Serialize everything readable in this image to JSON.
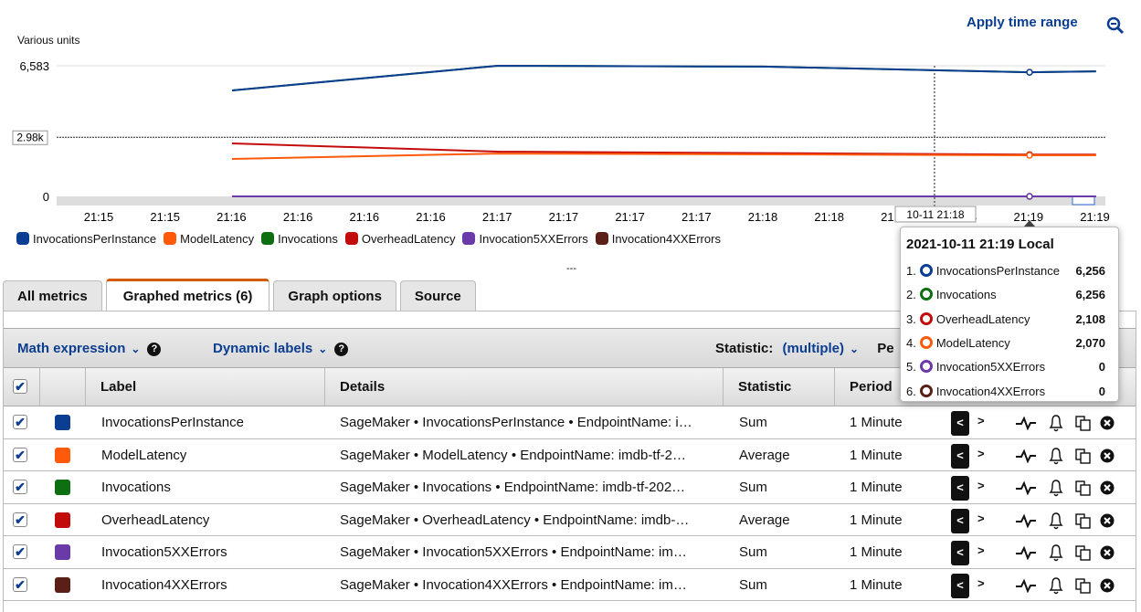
{
  "header": {
    "apply_time_range": "Apply time range",
    "zoom_icon": "zoom-out-icon"
  },
  "chart_data": {
    "type": "line",
    "ylabel": "Various units",
    "yticks": [
      "6,583",
      "0"
    ],
    "ylim": [
      0,
      6583
    ],
    "threshold_label": "2.98k",
    "threshold": 2980,
    "xtick_labels": [
      "21:15",
      "21:15",
      "21:16",
      "21:16",
      "21:16",
      "21:16",
      "21:17",
      "21:17",
      "21:17",
      "21:17",
      "21:18",
      "21:18",
      "21:18",
      "21:18",
      "21:19",
      "21:19"
    ],
    "x": [
      "21:16:00",
      "21:17:00",
      "21:18:00",
      "21:19:00",
      "21:19:15"
    ],
    "hover_x_label": "10-11 21:18",
    "series": [
      {
        "name": "InvocationsPerInstance",
        "color": "#0b3d91",
        "values": [
          5340,
          6583,
          6540,
          6256,
          6300
        ]
      },
      {
        "name": "ModelLatency",
        "color": "#ff5a0a",
        "values": [
          1890,
          2160,
          2120,
          2070,
          2070
        ]
      },
      {
        "name": "Invocations",
        "color": "#0e6e12",
        "values": [
          5340,
          6583,
          6540,
          6256,
          6300
        ]
      },
      {
        "name": "OverheadLatency",
        "color": "#c20c0c",
        "values": [
          2670,
          2255,
          2180,
          2108,
          2108
        ]
      },
      {
        "name": "Invocation5XXErrors",
        "color": "#6a3aa8",
        "values": [
          0,
          0,
          0,
          0,
          0
        ]
      },
      {
        "name": "Invocation4XXErrors",
        "color": "#5a1f17",
        "values": [
          0,
          0,
          0,
          0,
          0
        ]
      }
    ]
  },
  "tooltip": {
    "title": "2021-10-11 21:19 Local",
    "items": [
      {
        "n": "1.",
        "name": "InvocationsPerInstance",
        "value": "6,256",
        "color": "#0b3d91"
      },
      {
        "n": "2.",
        "name": "Invocations",
        "value": "6,256",
        "color": "#0e6e12"
      },
      {
        "n": "3.",
        "name": "OverheadLatency",
        "value": "2,108",
        "color": "#c20c0c"
      },
      {
        "n": "4.",
        "name": "ModelLatency",
        "value": "2,070",
        "color": "#ff5a0a"
      },
      {
        "n": "5.",
        "name": "Invocation5XXErrors",
        "value": "0",
        "color": "#6a3aa8"
      },
      {
        "n": "6.",
        "name": "Invocation4XXErrors",
        "value": "0",
        "color": "#5a1f17"
      }
    ]
  },
  "divider": "---",
  "tabs": [
    "All metrics",
    "Graphed metrics (6)",
    "Graph options",
    "Source"
  ],
  "toolbar": {
    "math": "Math expression",
    "dynamic": "Dynamic labels",
    "statistic_label": "Statistic:",
    "statistic_value": "(multiple)",
    "period_label": "Pe"
  },
  "columns": {
    "label": "Label",
    "details": "Details",
    "statistic": "Statistic",
    "period": "Period"
  },
  "rows": [
    {
      "label": "InvocationsPerInstance",
      "color": "#0b3d91",
      "details": "SageMaker • InvocationsPerInstance • EndpointName: i…",
      "statistic": "Sum",
      "period": "1 Minute"
    },
    {
      "label": "ModelLatency",
      "color": "#ff5a0a",
      "details": "SageMaker • ModelLatency • EndpointName: imdb-tf-2…",
      "statistic": "Average",
      "period": "1 Minute"
    },
    {
      "label": "Invocations",
      "color": "#0e6e12",
      "details": "SageMaker • Invocations • EndpointName: imdb-tf-202…",
      "statistic": "Sum",
      "period": "1 Minute"
    },
    {
      "label": "OverheadLatency",
      "color": "#c20c0c",
      "details": "SageMaker • OverheadLatency • EndpointName: imdb-…",
      "statistic": "Average",
      "period": "1 Minute"
    },
    {
      "label": "Invocation5XXErrors",
      "color": "#6a3aa8",
      "details": "SageMaker • Invocation5XXErrors • EndpointName: im…",
      "statistic": "Sum",
      "period": "1 Minute"
    },
    {
      "label": "Invocation4XXErrors",
      "color": "#5a1f17",
      "details": "SageMaker • Invocation4XXErrors • EndpointName: im…",
      "statistic": "Sum",
      "period": "1 Minute"
    }
  ]
}
